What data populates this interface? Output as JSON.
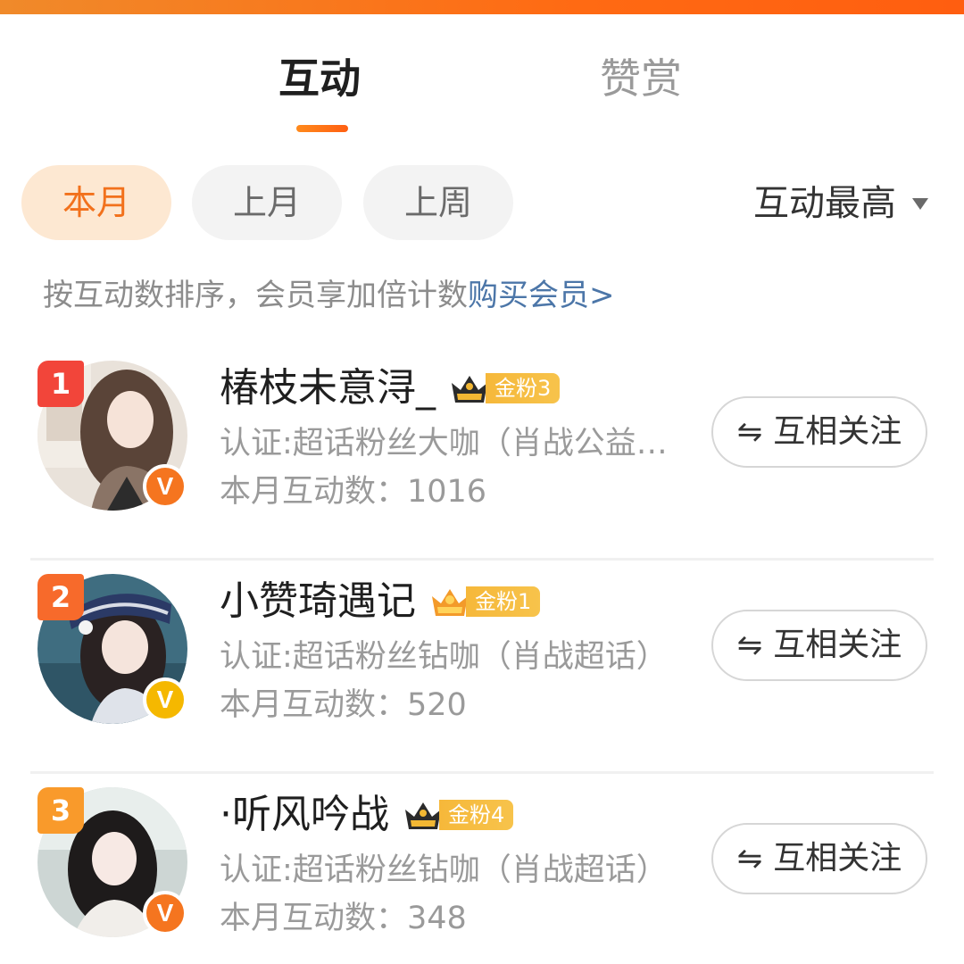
{
  "tabs": [
    {
      "label": "互动",
      "active": true
    },
    {
      "label": "赞赏",
      "active": false
    }
  ],
  "filters": [
    {
      "label": "本月",
      "active": true
    },
    {
      "label": "上月",
      "active": false
    },
    {
      "label": "上周",
      "active": false
    }
  ],
  "sort": {
    "label": "互动最高",
    "icon": "caret-down-icon"
  },
  "hint": {
    "text": "按互动数排序，会员享加倍计数",
    "link": "购买会员>"
  },
  "colors": {
    "accent": "#ff6a13",
    "link": "#4c76a8",
    "active_pill_bg": "#fde8d2"
  },
  "users": [
    {
      "rank": "1",
      "name": "椿枝未意浔_",
      "fan_badge": "金粉3",
      "cert": "认证:超话粉丝大咖（肖战公益…",
      "count": "本月互动数：1016",
      "verify": "V",
      "follow_label": "互相关注",
      "follow_icon": "⇋"
    },
    {
      "rank": "2",
      "name": "小赞琦遇记",
      "fan_badge": "金粉1",
      "cert": "认证:超话粉丝钻咖（肖战超话）",
      "count": "本月互动数：520",
      "verify": "V",
      "follow_label": "互相关注",
      "follow_icon": "⇋"
    },
    {
      "rank": "3",
      "name": "·听风吟战",
      "fan_badge": "金粉4",
      "cert": "认证:超话粉丝钻咖（肖战超话）",
      "count": "本月互动数：348",
      "verify": "V",
      "follow_label": "互相关注",
      "follow_icon": "⇋"
    }
  ]
}
